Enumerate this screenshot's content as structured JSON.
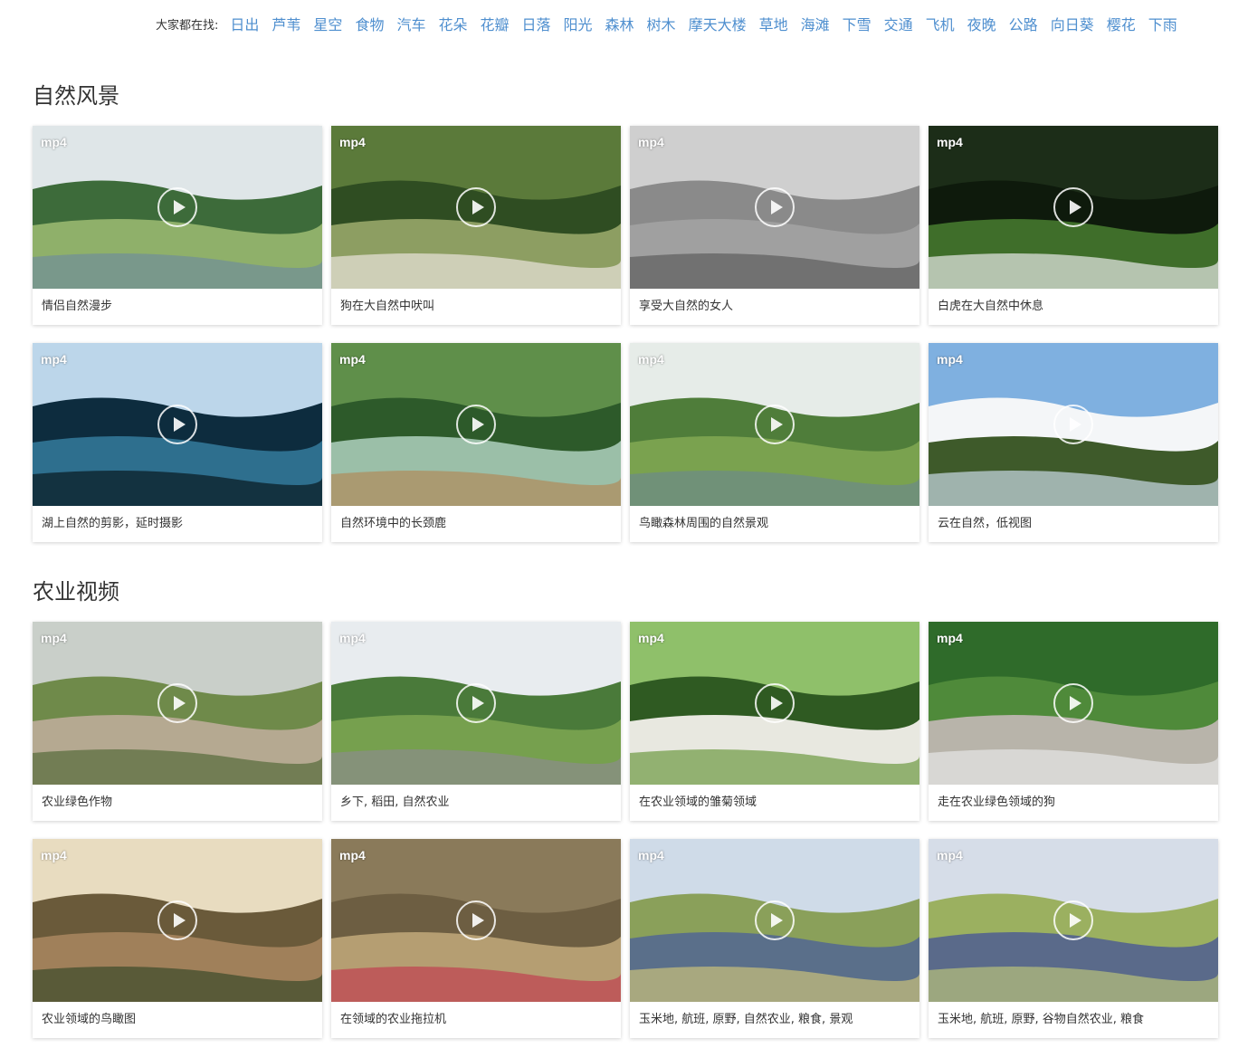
{
  "hot_searches": {
    "label": "大家都在找:",
    "tags": [
      "日出",
      "芦苇",
      "星空",
      "食物",
      "汽车",
      "花朵",
      "花瓣",
      "日落",
      "阳光",
      "森林",
      "树木",
      "摩天大楼",
      "草地",
      "海滩",
      "下雪",
      "交通",
      "飞机",
      "夜晚",
      "公路",
      "向日葵",
      "樱花",
      "下雨"
    ]
  },
  "sections": [
    {
      "title": "自然风景",
      "videos": [
        {
          "format": "mp4",
          "title": "情侣自然漫步",
          "icon": "play-icon"
        },
        {
          "format": "mp4",
          "title": "狗在大自然中吠叫",
          "icon": "play-icon"
        },
        {
          "format": "mp4",
          "title": "享受大自然的女人",
          "icon": "play-icon"
        },
        {
          "format": "mp4",
          "title": "白虎在大自然中休息",
          "icon": "play-icon"
        },
        {
          "format": "mp4",
          "title": "湖上自然的剪影，延时摄影",
          "icon": "play-icon"
        },
        {
          "format": "mp4",
          "title": "自然环境中的长颈鹿",
          "icon": "play-icon"
        },
        {
          "format": "mp4",
          "title": "鸟瞰森林周围的自然景观",
          "icon": "play-icon"
        },
        {
          "format": "mp4",
          "title": "云在自然，低视图",
          "icon": "play-icon"
        }
      ]
    },
    {
      "title": "农业视频",
      "videos": [
        {
          "format": "mp4",
          "title": "农业绿色作物",
          "icon": "play-icon"
        },
        {
          "format": "mp4",
          "title": "乡下, 稻田, 自然农业",
          "icon": "play-icon"
        },
        {
          "format": "mp4",
          "title": "在农业领域的雏菊领域",
          "icon": "play-icon"
        },
        {
          "format": "mp4",
          "title": "走在农业绿色领域的狗",
          "icon": "play-icon"
        },
        {
          "format": "mp4",
          "title": "农业领域的鸟瞰图",
          "icon": "play-icon"
        },
        {
          "format": "mp4",
          "title": "在领域的农业拖拉机",
          "icon": "play-icon"
        },
        {
          "format": "mp4",
          "title": "玉米地, 航班, 原野, 自然农业, 粮食, 景观",
          "icon": "play-icon"
        },
        {
          "format": "mp4",
          "title": "玉米地, 航班, 原野, 谷物自然农业, 粮食",
          "icon": "play-icon"
        }
      ]
    }
  ],
  "colors": {
    "link": "#4f8fcf",
    "text": "#333333"
  }
}
